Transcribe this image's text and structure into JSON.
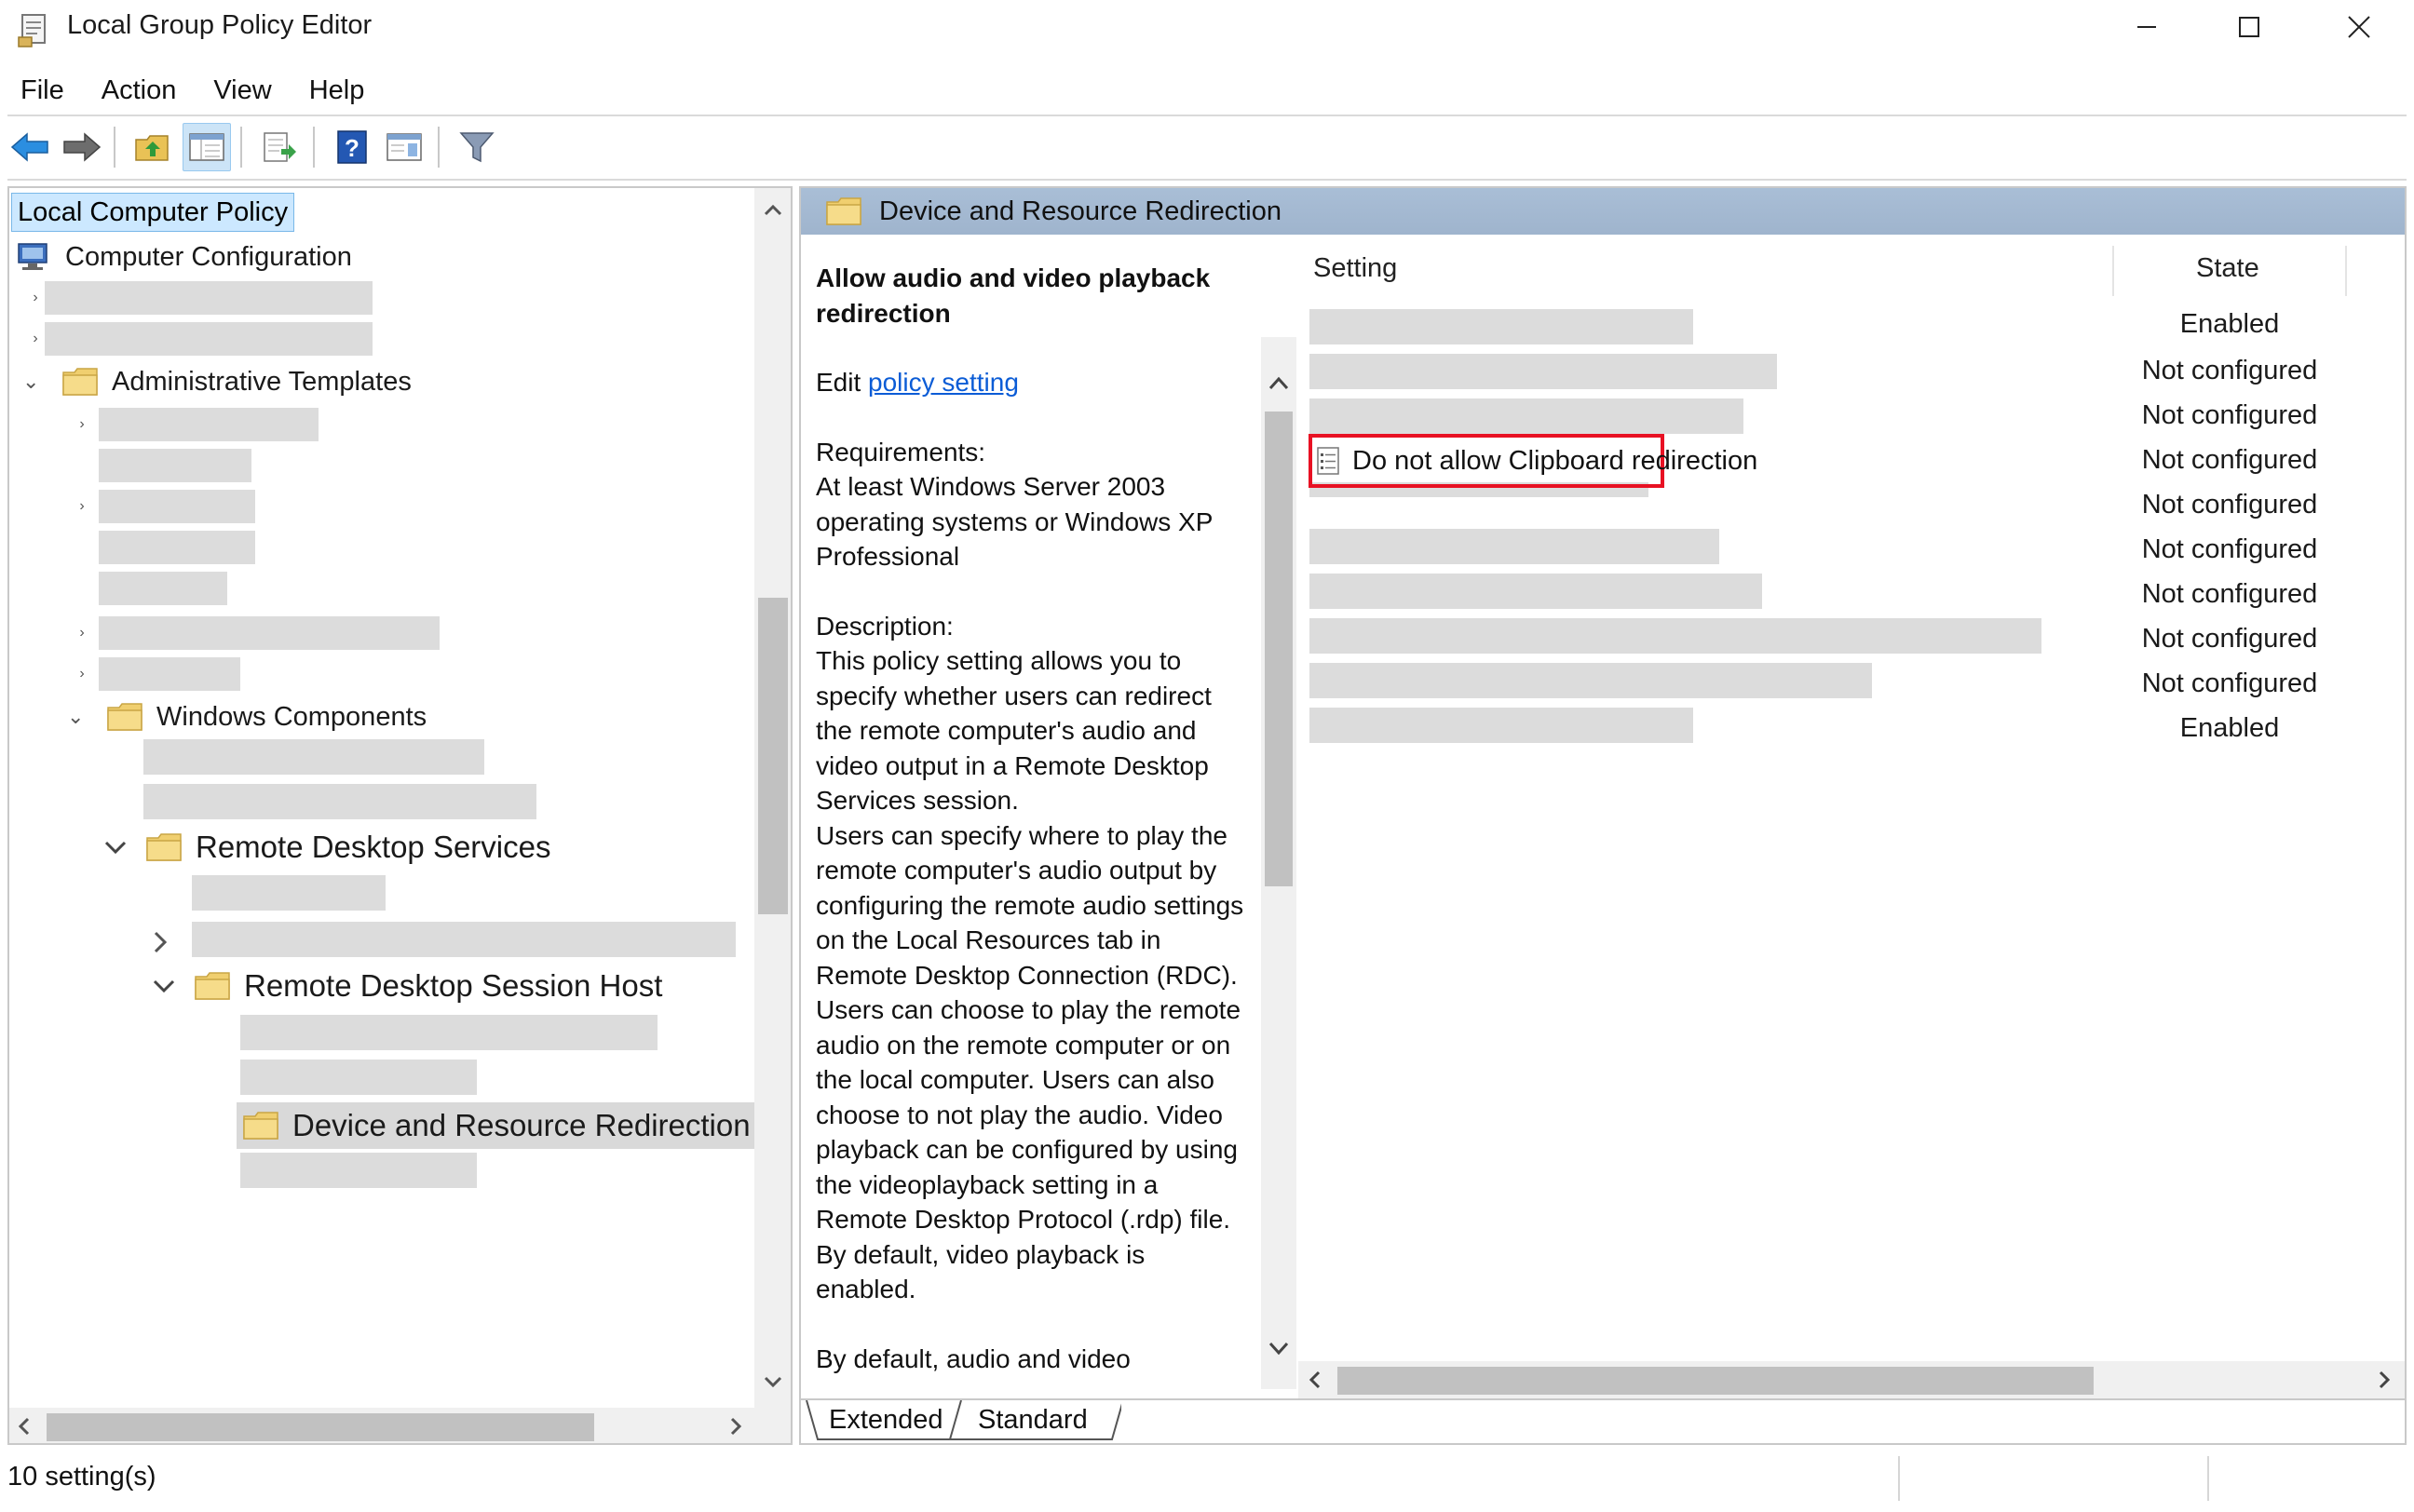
{
  "window": {
    "title": "Local Group Policy Editor",
    "controls": {
      "minimize": "minimize",
      "maximize": "maximize",
      "close": "close"
    }
  },
  "menu": {
    "items": [
      "File",
      "Action",
      "View",
      "Help"
    ]
  },
  "toolbar": {
    "buttons": [
      "back-icon",
      "forward-icon",
      "up-folder-icon",
      "show-hide-tree-icon",
      "export-list-icon",
      "help-icon",
      "extended-view-icon",
      "filter-icon"
    ]
  },
  "tree": {
    "root": "Local Computer Policy",
    "computer_configuration": "Computer Configuration",
    "administrative_templates": "Administrative Templates",
    "windows_components": "Windows Components",
    "remote_desktop_services": "Remote Desktop Services",
    "remote_desktop_session_host": "Remote Desktop Session Host",
    "device_and_resource_redirection": "Device and Resource Redirection"
  },
  "details": {
    "header": "Device and Resource Redirection",
    "description": {
      "title": "Allow audio and video playback redirection",
      "edit_prefix": "Edit",
      "edit_link": "policy setting",
      "requirements_label": "Requirements:",
      "requirements_text": "At least Windows Server 2003 operating systems or Windows XP Professional",
      "description_label": "Description:",
      "description_text_1": "This policy setting allows you to specify whether users can redirect the remote computer's audio and video output in a Remote Desktop Services session.",
      "description_text_2": "Users can specify where to play the remote computer's audio output by configuring the remote audio settings on the Local Resources tab in Remote Desktop Connection (RDC). Users can choose to play the remote audio on the remote computer or on the local computer. Users can also choose to not play the audio. Video playback can be configured by using the videoplayback setting in a Remote Desktop Protocol (.rdp) file. By default, video playback is enabled.",
      "description_text_3": "By default, audio and video"
    },
    "columns": {
      "setting": "Setting",
      "state": "State"
    },
    "highlighted_setting": "Do not allow Clipboard redirection",
    "states": [
      "Enabled",
      "Not configured",
      "Not configured",
      "Not configured",
      "Not configured",
      "Not configured",
      "Not configured",
      "Not configured",
      "Not configured",
      "Enabled"
    ]
  },
  "tabs": {
    "extended": "Extended",
    "standard": "Standard"
  },
  "status": {
    "text": "10 setting(s)"
  }
}
